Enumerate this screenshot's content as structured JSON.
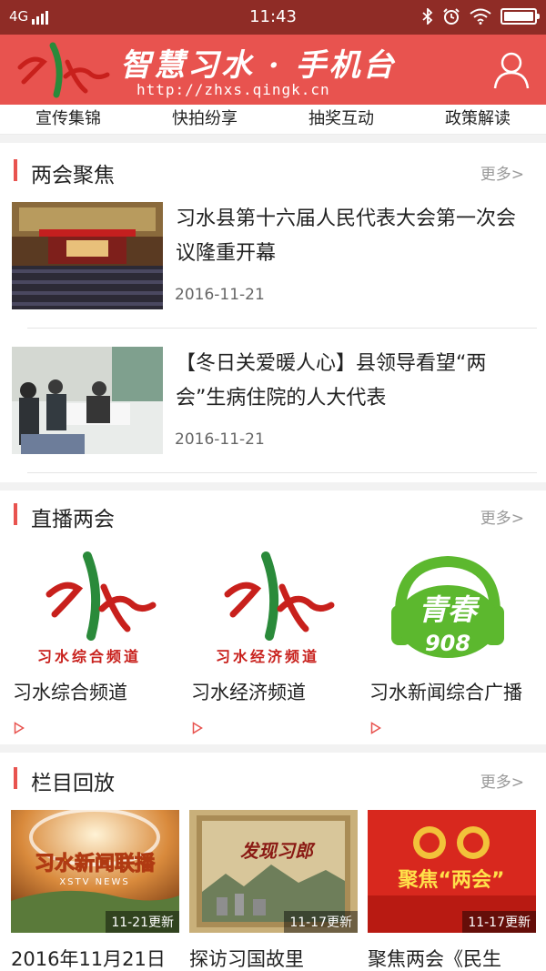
{
  "status_bar": {
    "network": "4G",
    "time": "11:43"
  },
  "header": {
    "brand_title": "智慧习水 · 手机台",
    "brand_url": "http://zhxs.qingk.cn",
    "colors": {
      "header_bg": "#e8534f",
      "status_bg": "#8f2c26",
      "accent": "#e8534f"
    }
  },
  "nav": {
    "items": [
      "宣传集锦",
      "快拍纷享",
      "抽奖互动",
      "政策解读"
    ]
  },
  "focus": {
    "title": "两会聚焦",
    "more": "更多>",
    "items": [
      {
        "title": "习水县第十六届人民代表大会第一次会议隆重开幕",
        "date": "2016-11-21"
      },
      {
        "title": "【冬日关爱暖人心】县领导看望“两会”生病住院的人大代表",
        "date": "2016-11-21"
      }
    ]
  },
  "live": {
    "title": "直播两会",
    "more": "更多>",
    "channels": [
      {
        "name": "习水综合频道",
        "logo_text": "习水综合频道",
        "has_play": true
      },
      {
        "name": "习水经济频道",
        "logo_text": "习水经济频道",
        "has_play": true
      },
      {
        "name": "习水新闻综合广播",
        "logo_text": "青春",
        "logo_number": "908",
        "has_play": true
      }
    ]
  },
  "replay": {
    "title": "栏目回放",
    "more": "更多>",
    "items": [
      {
        "title": "2016年11月21日",
        "badge": "11-21更新",
        "thumb_text": "习水新闻联播",
        "thumb_sub": "XSTV NEWS"
      },
      {
        "title": "探访习国故里",
        "badge": "11-17更新",
        "thumb_text": "发现习郎"
      },
      {
        "title": "聚焦两会《民生",
        "badge": "11-17更新",
        "thumb_text": "聚焦“两会”"
      }
    ]
  }
}
